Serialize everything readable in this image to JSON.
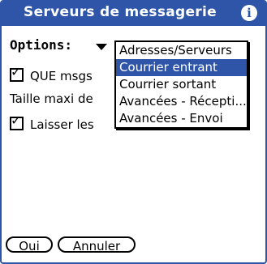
{
  "header": {
    "title": "Serveurs de messagerie",
    "info_icon": "info-icon"
  },
  "options": {
    "label": "Options:"
  },
  "rows": {
    "que_msgs": "QUE msgs",
    "taille": "Taille maxi de",
    "laisser": "Laisser les"
  },
  "menu": {
    "items": [
      {
        "label": "Adresses/Serveurs",
        "selected": false
      },
      {
        "label": "Courrier entrant",
        "selected": true
      },
      {
        "label": "Courrier sortant",
        "selected": false
      },
      {
        "label": "Avancées - Récepti...",
        "selected": false
      },
      {
        "label": "Avancées - Envoi",
        "selected": false
      }
    ]
  },
  "buttons": {
    "ok": "Oui",
    "cancel": "Annuler"
  },
  "colors": {
    "accent": "#2f55a8"
  }
}
